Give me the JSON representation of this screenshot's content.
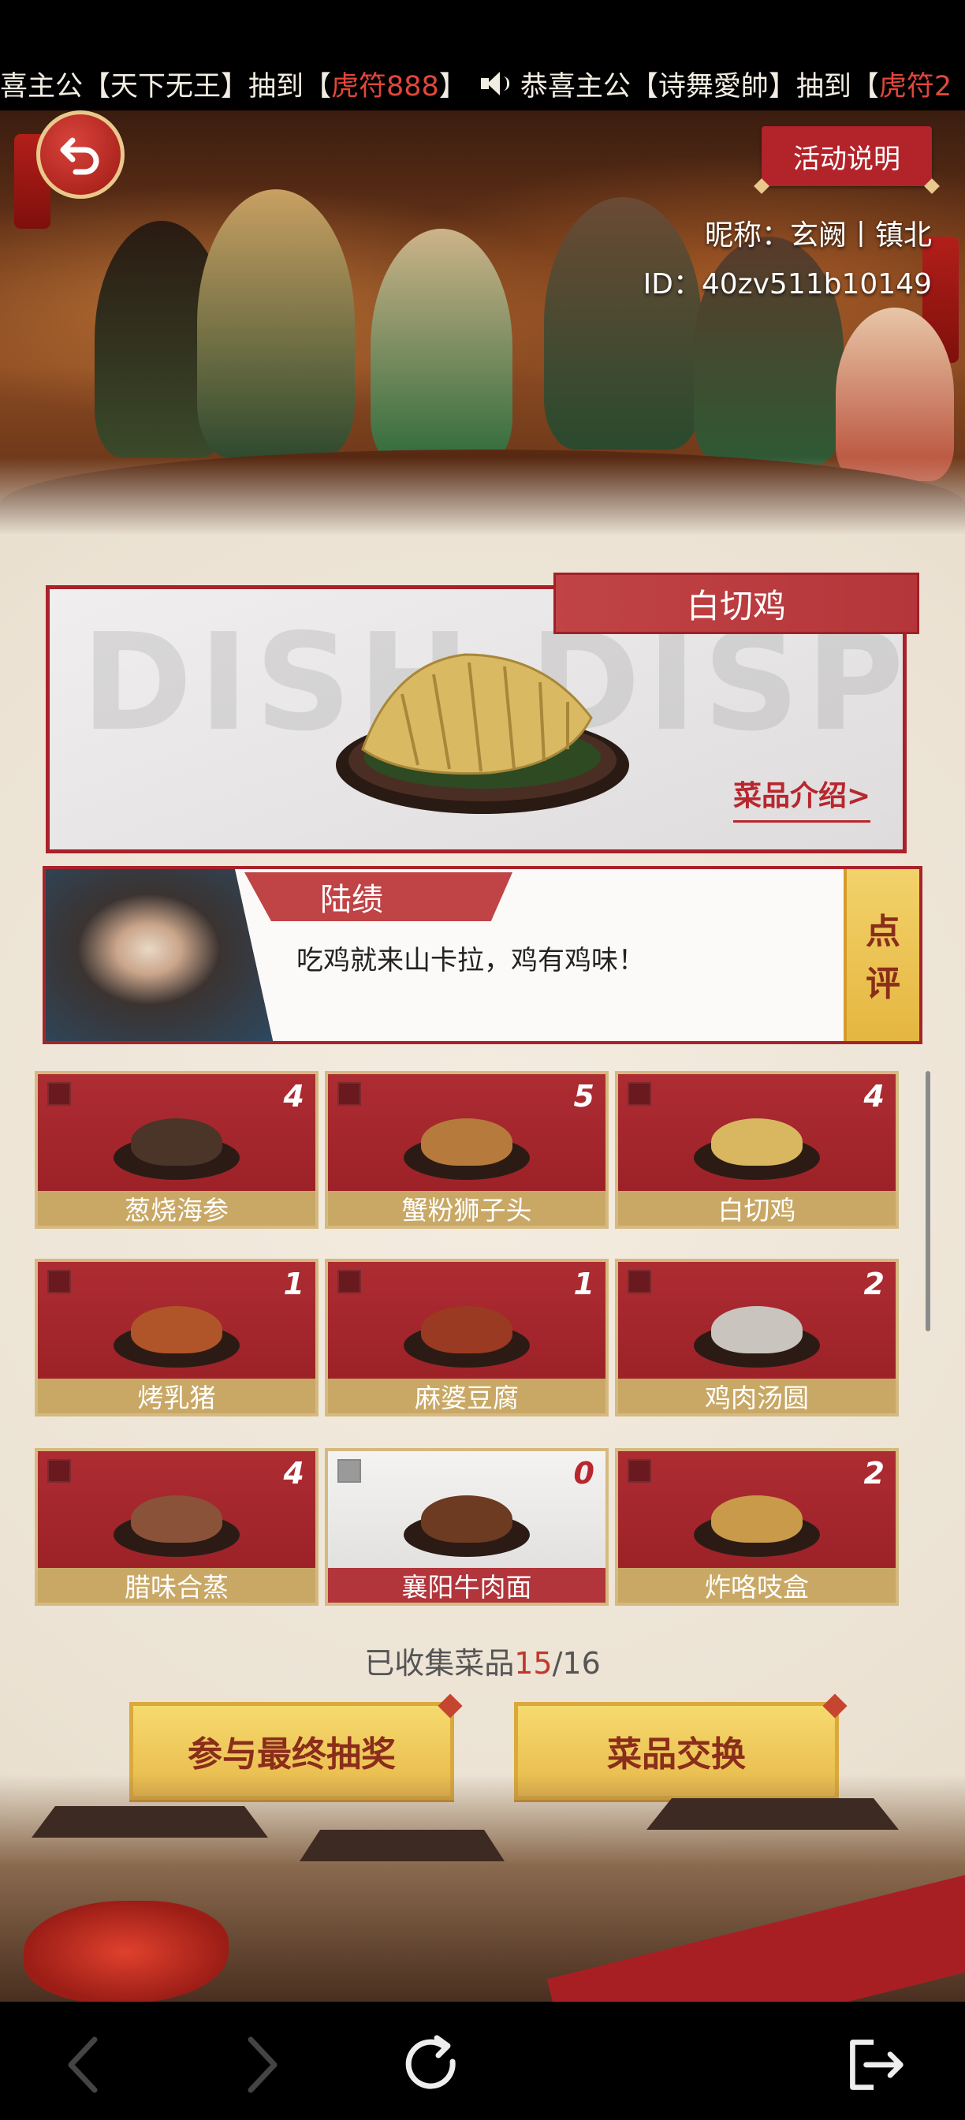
{
  "marquee": {
    "p1": "喜主公【天下无王】抽到【",
    "h1": "虎符888",
    "p2": "】",
    "p3": "恭喜主公【诗舞愛帥】抽到【",
    "h2": "虎符2"
  },
  "header": {
    "rules_label": "活动说明",
    "nickname": "昵称：玄阙丨镇北",
    "user_id": "ID：40zv511b10149"
  },
  "featured": {
    "ghost_text": "DISH DISPLAY",
    "title": "白切鸡",
    "intro_link": "菜品介绍>"
  },
  "comment": {
    "name": "陆绩",
    "text": "吃鸡就来山卡拉，鸡有鸡味！",
    "rate_char1": "点",
    "rate_char2": "评"
  },
  "dishes": [
    {
      "name": "葱烧海参",
      "count": "4",
      "food_color": "#4a3528"
    },
    {
      "name": "蟹粉狮子头",
      "count": "5",
      "food_color": "#b67a3c"
    },
    {
      "name": "白切鸡",
      "count": "4",
      "food_color": "#d8b760"
    },
    {
      "name": "烤乳猪",
      "count": "1",
      "food_color": "#b0542a"
    },
    {
      "name": "麻婆豆腐",
      "count": "1",
      "food_color": "#9a3a22"
    },
    {
      "name": "鸡肉汤圆",
      "count": "2",
      "food_color": "#c9c4bd"
    },
    {
      "name": "腊味合蒸",
      "count": "4",
      "food_color": "#8a5238"
    },
    {
      "name": "襄阳牛肉面",
      "count": "0",
      "food_color": "#6d3a22"
    },
    {
      "name": "炸咯吱盒",
      "count": "2",
      "food_color": "#c89a4a"
    }
  ],
  "collection": {
    "prefix": "已收集菜品",
    "current": "15",
    "sep": "/",
    "total": "16"
  },
  "actions": {
    "draw_label": "参与最终抽奖",
    "exchange_label": "菜品交换"
  },
  "colors": {
    "accent_red": "#b3232a",
    "gold": "#e7b84a"
  },
  "icons": {
    "back": "back-arrow-icon",
    "speaker": "speaker-icon",
    "nav_back": "chevron-left-icon",
    "nav_forward": "chevron-right-icon",
    "nav_reload": "reload-icon",
    "nav_exit": "exit-icon"
  }
}
